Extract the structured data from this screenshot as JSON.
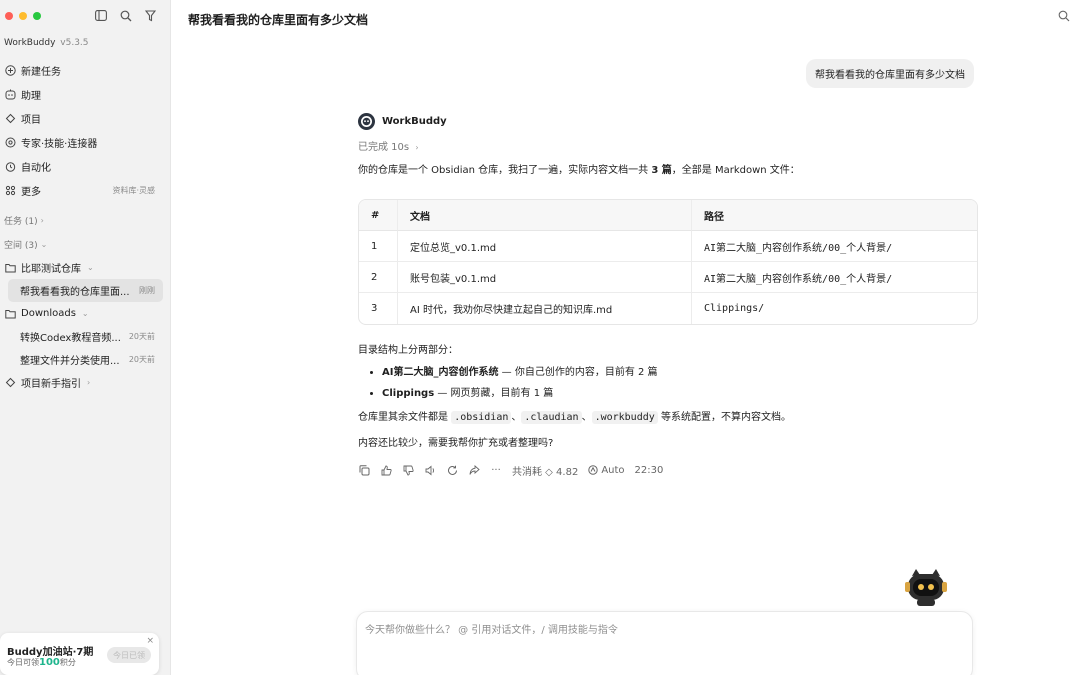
{
  "sidebar": {
    "brand": "WorkBuddy",
    "version": "v5.3.5",
    "nav": [
      {
        "label": "新建任务",
        "icon": "plus-circle-icon"
      },
      {
        "label": "助理",
        "icon": "assistant-icon"
      },
      {
        "label": "项目",
        "icon": "project-icon"
      },
      {
        "label": "专家·技能·连接器",
        "icon": "expert-icon"
      },
      {
        "label": "自动化",
        "icon": "clock-icon"
      },
      {
        "label": "更多",
        "icon": "grid-icon",
        "hint": "资料库·灵感"
      }
    ],
    "tasks_label": "任务 (1)",
    "spaces_label": "空间 (3)",
    "spaces": [
      {
        "label": "比耶测试仓库",
        "children": [
          {
            "label": "帮我看看我的仓库里面...",
            "time": "刚刚",
            "active": true
          }
        ]
      },
      {
        "label": "Downloads",
        "children": [
          {
            "label": "转换Codex教程音频...",
            "time": "20天前"
          },
          {
            "label": "整理文件并分类使用...",
            "time": "20天前"
          }
        ]
      },
      {
        "label": "项目新手指引",
        "children": []
      }
    ],
    "promo": {
      "title": "Buddy加油站·7期",
      "sub_prefix": "今日可领",
      "points": "100",
      "sub_suffix": "积分",
      "button": "今日已领",
      "close": "×"
    }
  },
  "main": {
    "title": "帮我看看我的仓库里面有多少文档",
    "user_message": "帮我看看我的仓库里面有多少文档",
    "bot_name": "WorkBuddy",
    "status": "已完成 10s",
    "intro_pre": "你的仓库是一个 Obsidian 仓库，我扫了一遍，实际内容文档一共 ",
    "intro_bold": "3 篇",
    "intro_post": "，全部是 Markdown 文件：",
    "table": {
      "headers": [
        "#",
        "文档",
        "路径"
      ],
      "rows": [
        [
          "1",
          "定位总览_v0.1.md",
          "AI第二大脑_内容创作系统/00_个人背景/"
        ],
        [
          "2",
          "账号包装_v0.1.md",
          "AI第二大脑_内容创作系统/00_个人背景/"
        ],
        [
          "3",
          "AI 时代，我劝你尽快建立起自己的知识库.md",
          "Clippings/"
        ]
      ]
    },
    "structure_intro": "目录结构上分两部分：",
    "bullets": [
      {
        "bold": "AI第二大脑_内容创作系统",
        "rest": " — 你自己创作的内容，目前有 2 篇"
      },
      {
        "bold": "Clippings",
        "rest": " — 网页剪藏，目前有 1 篇"
      }
    ],
    "config_pre": "仓库里其余文件都是 ",
    "config_codes": [
      ".obsidian",
      ".claudian",
      ".workbuddy"
    ],
    "config_sep": "、",
    "config_post": " 等系统配置，不算内容文档。",
    "closing": "内容还比较少，需要我帮你扩充或者整理吗?",
    "actions": {
      "cost": "共消耗 ◇ 4.82",
      "model": "Auto",
      "time": "22:30"
    },
    "composer_placeholder": "今天帮你做些什么？ @ 引用对话文件，/ 调用技能与指令"
  }
}
